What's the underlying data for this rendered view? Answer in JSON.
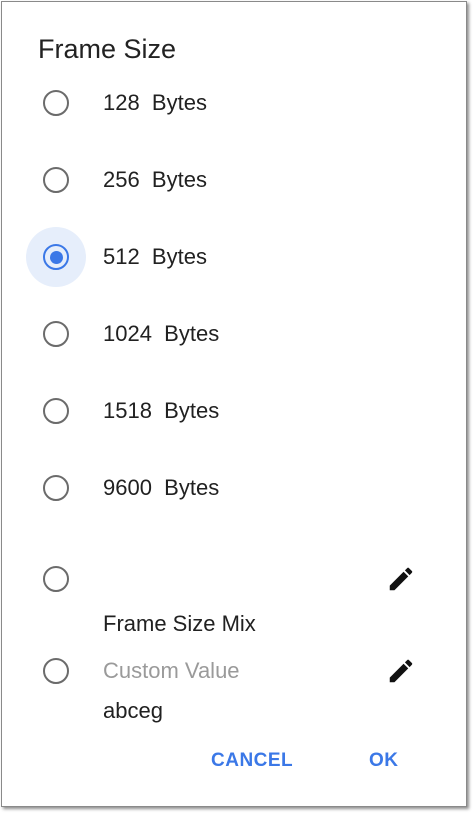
{
  "dialog": {
    "title": "Frame Size",
    "options": [
      {
        "label": "128  Bytes",
        "selected": false
      },
      {
        "label": "256  Bytes",
        "selected": false
      },
      {
        "label": "512  Bytes",
        "selected": true
      },
      {
        "label": "1024  Bytes",
        "selected": false
      },
      {
        "label": "1518  Bytes",
        "selected": false
      },
      {
        "label": "9600  Bytes",
        "selected": false
      }
    ],
    "mix": {
      "line1": "Frame Size Mix",
      "line2": "abceg",
      "icon": "pencil-icon"
    },
    "custom": {
      "placeholder": "Custom Value",
      "icon": "pencil-icon"
    },
    "buttons": {
      "cancel": "CANCEL",
      "ok": "OK"
    },
    "colors": {
      "accent": "#3b78e7",
      "selected_bg": "#e6eefb"
    }
  }
}
